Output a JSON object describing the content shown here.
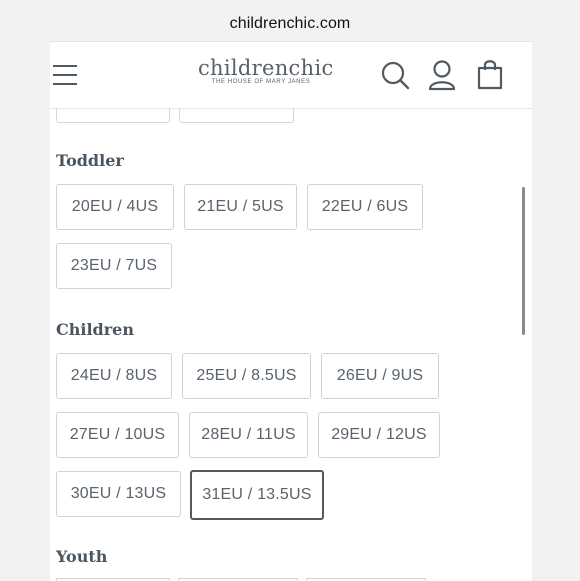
{
  "browser": {
    "url": "childrenchic.com"
  },
  "header": {
    "logo_text": "childrenchic",
    "logo_tagline": "THE HOUSE OF MARY JANES",
    "icons": [
      "menu-icon",
      "search-icon",
      "account-icon",
      "bag-icon"
    ]
  },
  "sections": {
    "toddler": {
      "title": "Toddler",
      "sizes": [
        "20EU / 4US",
        "21EU / 5US",
        "22EU / 6US",
        "23EU / 7US"
      ]
    },
    "children": {
      "title": "Children",
      "sizes": [
        "24EU / 8US",
        "25EU / 8.5US",
        "26EU / 9US",
        "27EU / 10US",
        "28EU / 11US",
        "29EU / 12US",
        "30EU / 13US",
        "31EU / 13.5US"
      ]
    },
    "youth": {
      "title": "Youth"
    }
  },
  "selected_size": "31EU / 13.5US",
  "colors": {
    "text": "#59636d",
    "border": "#cfd3d6",
    "selected_border": "#4f5a63",
    "heading": "#4a5560"
  }
}
